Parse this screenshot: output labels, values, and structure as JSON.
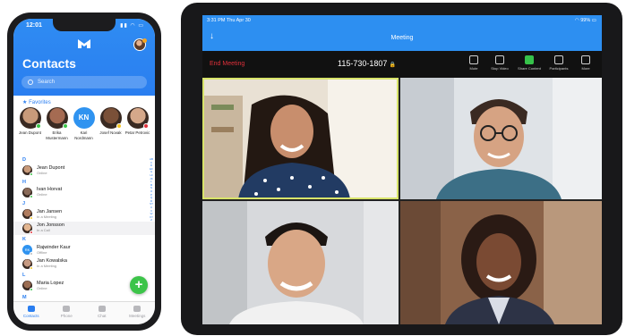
{
  "phone": {
    "time": "12:01",
    "title": "Contacts",
    "search_placeholder": "Search",
    "favorites_label": "Favorites",
    "favorites": [
      {
        "name": "Jean Dupont",
        "color": "#c89a7a",
        "status": "#3cc449"
      },
      {
        "name": "Erika Mustermann",
        "color": "#a56b52",
        "status": "#3cc449"
      },
      {
        "name": "Kari Nordmann",
        "initials": "KN",
        "status": "#bdbdbd"
      },
      {
        "name": "Josef Novak",
        "color": "#7a5038",
        "status": "#f5c623"
      },
      {
        "name": "Petar Petrovic",
        "color": "#d5a88a",
        "status": "#e0303a"
      }
    ],
    "sections": [
      {
        "letter": "D",
        "contacts": [
          {
            "name": "Jean Dupont",
            "status": "Online",
            "dot": "#3cc449",
            "color": "#c89a7a"
          }
        ]
      },
      {
        "letter": "H",
        "contacts": [
          {
            "name": "Ivan Horvat",
            "status": "Online",
            "dot": "#3cc449",
            "color": "#8a6a58"
          }
        ]
      },
      {
        "letter": "J",
        "contacts": [
          {
            "name": "Jan Jansen",
            "status": "In a Meeting",
            "dot": "#f5c623",
            "color": "#b07c5e"
          },
          {
            "name": "Jon Jonsson",
            "status": "In a Call",
            "dot": "#e0303a",
            "color": "#e2b590"
          }
        ]
      },
      {
        "letter": "K",
        "contacts": [
          {
            "name": "Rajwinder Kaur",
            "status": "Offline",
            "dot": "#bdbdbd",
            "color": "#2f93f0",
            "initials": "RK"
          },
          {
            "name": "Jan Kowalska",
            "status": "In a Meeting",
            "dot": "#f5c623",
            "color": "#c79a82"
          }
        ]
      },
      {
        "letter": "L",
        "contacts": [
          {
            "name": "Maria Lopez",
            "status": "Online",
            "dot": "#3cc449",
            "color": "#9c6d52"
          }
        ]
      },
      {
        "letter": "M",
        "contacts": []
      }
    ],
    "alphabet": "ABCDEFGHIJKLMNOPQRSTUVWXYZ",
    "tabs": [
      "Contacts",
      "Phone",
      "Chat",
      "Meetings"
    ]
  },
  "tablet": {
    "time": "3:31 PM  Thu Apr 30",
    "system": "99%",
    "title": "Meeting",
    "end_label": "End Meeting",
    "meeting_id": "115-730-1807",
    "controls": [
      "Mute",
      "Stop Video",
      "Share Content",
      "Participants",
      "More"
    ]
  },
  "colors": {
    "accent": "#2a7ef0",
    "online": "#3cc449",
    "busy": "#e0303a",
    "away": "#f5c623"
  }
}
